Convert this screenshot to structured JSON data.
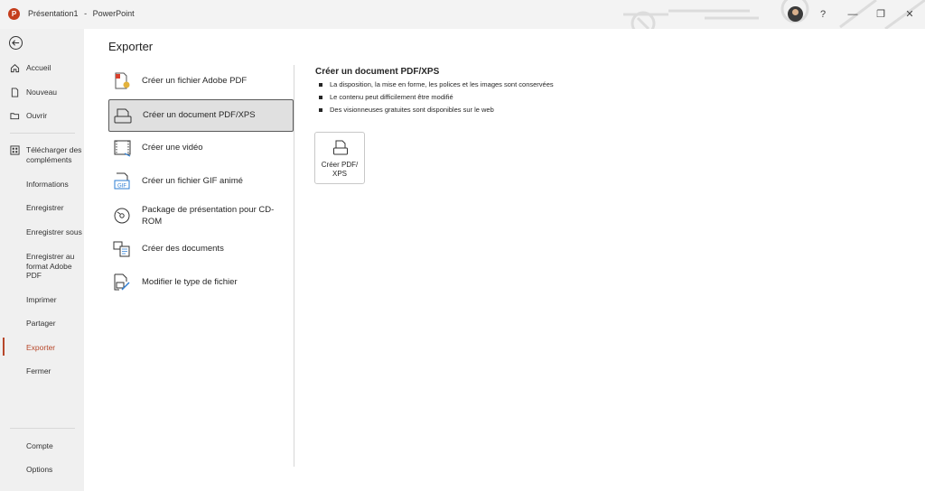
{
  "window": {
    "app_logo_letter": "P",
    "document_name": "Présentation1",
    "separator": "-",
    "app_name": "PowerPoint",
    "help_symbol": "?",
    "minimize_symbol": "—",
    "restore_symbol": "❐",
    "close_symbol": "✕"
  },
  "sidebar": {
    "items": [
      {
        "label": "Accueil",
        "icon": "home-icon"
      },
      {
        "label": "Nouveau",
        "icon": "new-document-icon"
      },
      {
        "label": "Ouvrir",
        "icon": "folder-open-icon"
      },
      {
        "label": "Télécharger des compléments",
        "icon": "addins-grid-icon"
      },
      {
        "label": "Informations"
      },
      {
        "label": "Enregistrer"
      },
      {
        "label": "Enregistrer sous"
      },
      {
        "label": "Enregistrer au format Adobe PDF"
      },
      {
        "label": "Imprimer"
      },
      {
        "label": "Partager"
      },
      {
        "label": "Exporter",
        "active": true
      },
      {
        "label": "Fermer"
      }
    ],
    "bottom_items": [
      {
        "label": "Compte"
      },
      {
        "label": "Options"
      }
    ]
  },
  "main": {
    "title": "Exporter",
    "options": [
      {
        "label": "Créer un fichier Adobe PDF",
        "icon": "adobe-pdf-icon"
      },
      {
        "label": "Créer un document PDF/XPS",
        "icon": "pdf-xps-icon",
        "selected": true
      },
      {
        "label": "Créer une vidéo",
        "icon": "video-icon"
      },
      {
        "label": "Créer un fichier GIF animé",
        "icon": "gif-icon",
        "badge": "GIF"
      },
      {
        "label": "Package de présentation pour CD-ROM",
        "icon": "cd-rom-icon"
      },
      {
        "label": "Créer des documents",
        "icon": "handouts-icon"
      },
      {
        "label": "Modifier le type de fichier",
        "icon": "change-file-type-icon"
      }
    ],
    "detail": {
      "title": "Créer un document PDF/XPS",
      "bullets": [
        "La disposition, la mise en forme, les polices et les images sont conservées",
        "Le contenu peut difficilement être modifié",
        "Des visionneuses gratuites sont disponibles sur le web"
      ],
      "create_button": {
        "label": "Créer PDF/ XPS",
        "icon": "pdf-xps-icon"
      }
    }
  },
  "colors": {
    "accent": "#b7472a",
    "sidebar_bg": "#f0f0f0",
    "titlebar_bg": "#f3f3f3",
    "selected_bg": "#e0e0e0"
  }
}
